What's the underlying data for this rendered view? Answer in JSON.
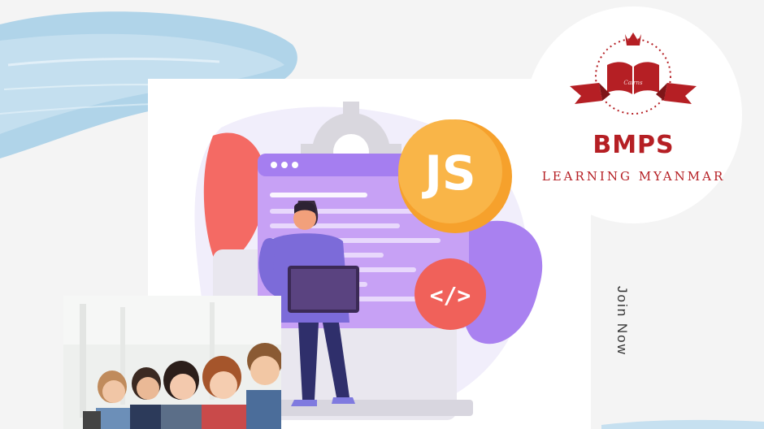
{
  "brand": {
    "name": "BMPS",
    "tagline": "LEARNING MYANMAR",
    "emblem_text": "Cairns",
    "color": "#b51f24"
  },
  "hero": {
    "js_badge": "JS",
    "code_badge": "</>"
  },
  "cta": {
    "join_label": "Join Now"
  },
  "colors": {
    "brush_blue": "#9cc8e2",
    "background": "#f4f4f4",
    "js_orange": "#f6a12c",
    "code_red": "#f0615a",
    "screen_purple": "#c7a1f5"
  },
  "icons": [
    "crown-icon",
    "open-book-icon",
    "ribbon-icon",
    "gear-icon",
    "laptop-icon"
  ]
}
